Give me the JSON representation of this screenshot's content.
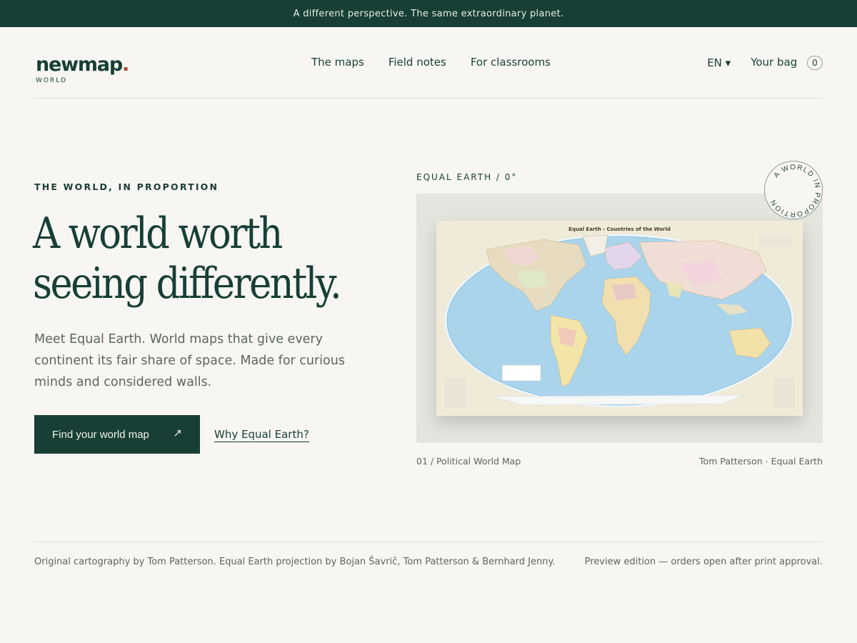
{
  "announcement": "A different perspective. The same extraordinary planet.",
  "logo": {
    "word": "newmap",
    "dot": ".",
    "sub": "WORLD"
  },
  "nav": [
    {
      "label": "The maps"
    },
    {
      "label": "Field notes"
    },
    {
      "label": "For classrooms"
    }
  ],
  "header": {
    "language": "EN ▾",
    "bag_label": "Your bag",
    "bag_count": "0"
  },
  "hero": {
    "eyebrow": "THE WORLD, IN PROPORTION",
    "headline_line1": "A world worth",
    "headline_line2": "seeing differently.",
    "lede": "Meet Equal Earth. World maps that give every continent its fair share of space. Made for curious minds and considered walls.",
    "cta_label": "Find your world map",
    "cta_arrow": "↗",
    "secondary_link": "Why Equal Earth?"
  },
  "map": {
    "label": "EQUAL EARTH / 0°",
    "poster_title": "Equal Earth - Countries of the World",
    "badge_text": "A WORLD IN PROPORTION",
    "caption_left": "01 / Political World Map",
    "caption_right": "Tom Patterson · Equal Earth"
  },
  "footer": {
    "credits": "Original cartography by Tom Patterson. Equal Earth projection by Bojan Šavrič, Tom Patterson & Bernhard Jenny.",
    "note": "Preview edition — orders open after print approval."
  },
  "colors": {
    "brand": "#173f35",
    "accent": "#b5432f",
    "background": "#f7f6f2",
    "ocean": "#a9d4ec"
  }
}
